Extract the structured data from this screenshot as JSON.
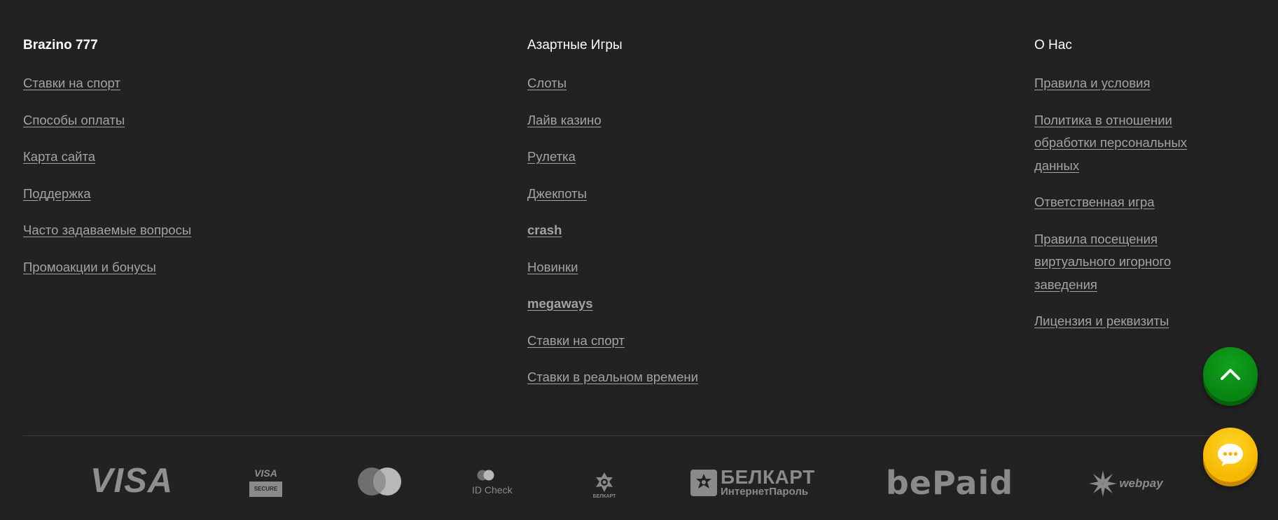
{
  "columns": [
    {
      "title": "Brazino 777",
      "links": [
        {
          "label": "Ставки на спорт"
        },
        {
          "label": "Способы оплаты"
        },
        {
          "label": "Карта сайта"
        },
        {
          "label": "Поддержка"
        },
        {
          "label": "Часто задаваемые вопросы"
        },
        {
          "label": "Промоакции и бонусы"
        }
      ]
    },
    {
      "title": "Азартные Игры",
      "links": [
        {
          "label": "Слоты"
        },
        {
          "label": "Лайв казино"
        },
        {
          "label": "Рулетка"
        },
        {
          "label": "Джекпоты"
        },
        {
          "label": "crash"
        },
        {
          "label": "Новинки"
        },
        {
          "label": "megaways"
        },
        {
          "label": "Ставки на спорт"
        },
        {
          "label": "Ставки в реальном времени"
        }
      ]
    },
    {
      "title": "О Нас",
      "links": [
        {
          "label": "Правила и условия"
        },
        {
          "label": "Политика в отношении обработки персональных данных"
        },
        {
          "label": "Ответственная игра"
        },
        {
          "label": "Правила посещения виртуального игорного заведения"
        },
        {
          "label": "Лицензия и реквизиты"
        }
      ]
    }
  ],
  "payments": {
    "visa": "VISA",
    "visa_secure_top": "VISA",
    "visa_secure_bottom": "SECURE",
    "mastercard_idcheck": "ID Check",
    "belkart_small": "БЕЛКАРТ",
    "belkart_title": "БЕЛКАРТ",
    "belkart_subtitle": "ИнтернетПароль",
    "bepaid": "bePaid",
    "webpay": "webpay"
  },
  "fab": {
    "scroll_top_icon": "chevron-up-icon",
    "chat_icon": "chat-bubble-icon"
  },
  "colors": {
    "background": "#222222",
    "heading": "#ffffff",
    "link": "#a3a3a3",
    "scroll_top_button": "#088412",
    "chat_button": "#f6b800"
  }
}
